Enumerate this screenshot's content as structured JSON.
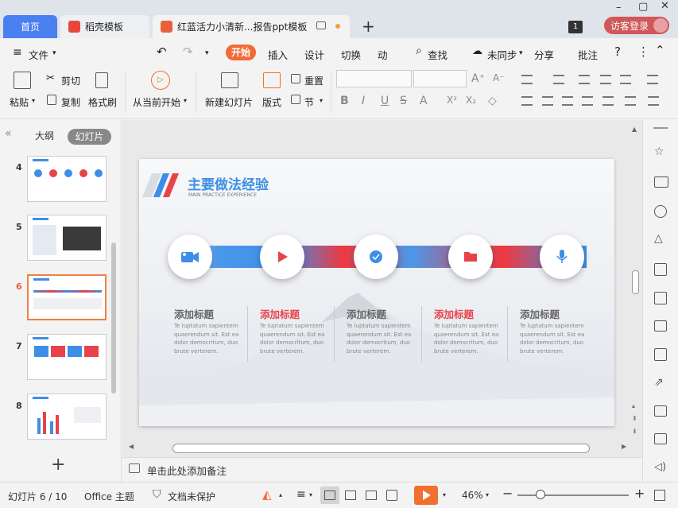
{
  "tabs": {
    "home": "首页",
    "daoke": "稻壳模板",
    "doc": "红蓝活力小清新...报告ppt模板"
  },
  "window": {
    "badge": "1",
    "visitor": "访客登录"
  },
  "menu": {
    "file": "文件",
    "start": "开始",
    "insert": "插入",
    "design": "设计",
    "switch": "切换",
    "anim": "动",
    "search": "查找",
    "sync": "未同步",
    "share": "分享",
    "annotate": "批注"
  },
  "ribbon": {
    "paste": "粘贴",
    "cut": "剪切",
    "copy": "复制",
    "format_brush": "格式刷",
    "from_current": "从当前开始",
    "new_slide": "新建幻灯片",
    "layout": "版式",
    "reset": "重置",
    "section": "节"
  },
  "left": {
    "outline": "大纲",
    "slides": "幻灯片",
    "numbers": [
      "4",
      "5",
      "6",
      "7",
      "8"
    ],
    "selected": "6"
  },
  "slide": {
    "title": "主要做法经验",
    "subtitle": "MAIN PRACTICE EXPERIENCE",
    "columns": [
      {
        "title": "添加标题",
        "text": "Te luptatum sapientem quaerendum sit. Est ea dolor democritum, duo brute verterem.",
        "icon": "video-camera-icon",
        "accent": false
      },
      {
        "title": "添加标题",
        "text": "Te luptatum sapientem quaerendum sit. Est ea dolor democritum, duo brute verterem.",
        "icon": "play-icon",
        "accent": true
      },
      {
        "title": "添加标题",
        "text": "Te luptatum sapientem quaerendum sit. Est ea dolor democritum, duo brute verterem.",
        "icon": "check-icon",
        "accent": false
      },
      {
        "title": "添加标题",
        "text": "Te luptatum sapientem quaerendum sit. Est ea dolor democritum, duo brute verterem.",
        "icon": "folder-icon",
        "accent": true
      },
      {
        "title": "添加标题",
        "text": "Te luptatum sapientem quaerendum sit. Est ea dolor democritum, duo brute verterem.",
        "icon": "microphone-icon",
        "accent": false
      }
    ]
  },
  "notes": {
    "placeholder": "单击此处添加备注"
  },
  "status": {
    "slide": "幻灯片 6 / 10",
    "theme": "Office 主题",
    "protect": "文档未保护",
    "zoom": "46%"
  },
  "colors": {
    "accent": "#f26a35",
    "red": "#e8434b",
    "blue": "#3d8ee6"
  }
}
